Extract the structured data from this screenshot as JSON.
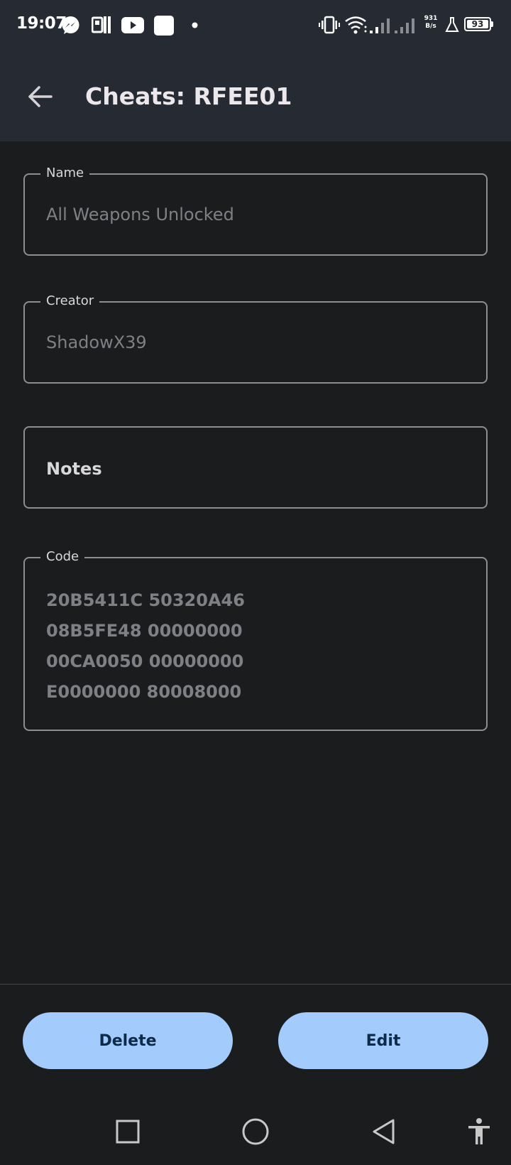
{
  "status_bar": {
    "time": "19:07",
    "net_speed_value": "931",
    "net_speed_unit": "B/s",
    "battery": "93",
    "icons": [
      "messenger-icon",
      "app-icon",
      "youtube-icon",
      "white-square-icon",
      "dot-icon",
      "vibrate-icon",
      "wifi-icon",
      "signal-icon",
      "signal-icon-2",
      "flask-icon",
      "battery-icon"
    ]
  },
  "app_bar": {
    "title": "Cheats: RFEE01"
  },
  "fields": {
    "name": {
      "label": "Name",
      "value": "All Weapons Unlocked"
    },
    "creator": {
      "label": "Creator",
      "value": "ShadowX39"
    },
    "notes": {
      "placeholder": "Notes"
    },
    "code": {
      "label": "Code",
      "lines": [
        "20B5411C 50320A46",
        "08B5FE48 00000000",
        "00CA0050 00000000",
        "E0000000 80008000"
      ]
    }
  },
  "actions": {
    "delete_label": "Delete",
    "edit_label": "Edit"
  },
  "colors": {
    "app_bar_bg": "#262a32",
    "background": "#1b1c1e",
    "button_bg": "#a3cbfc",
    "button_text": "#0c2a4a"
  }
}
